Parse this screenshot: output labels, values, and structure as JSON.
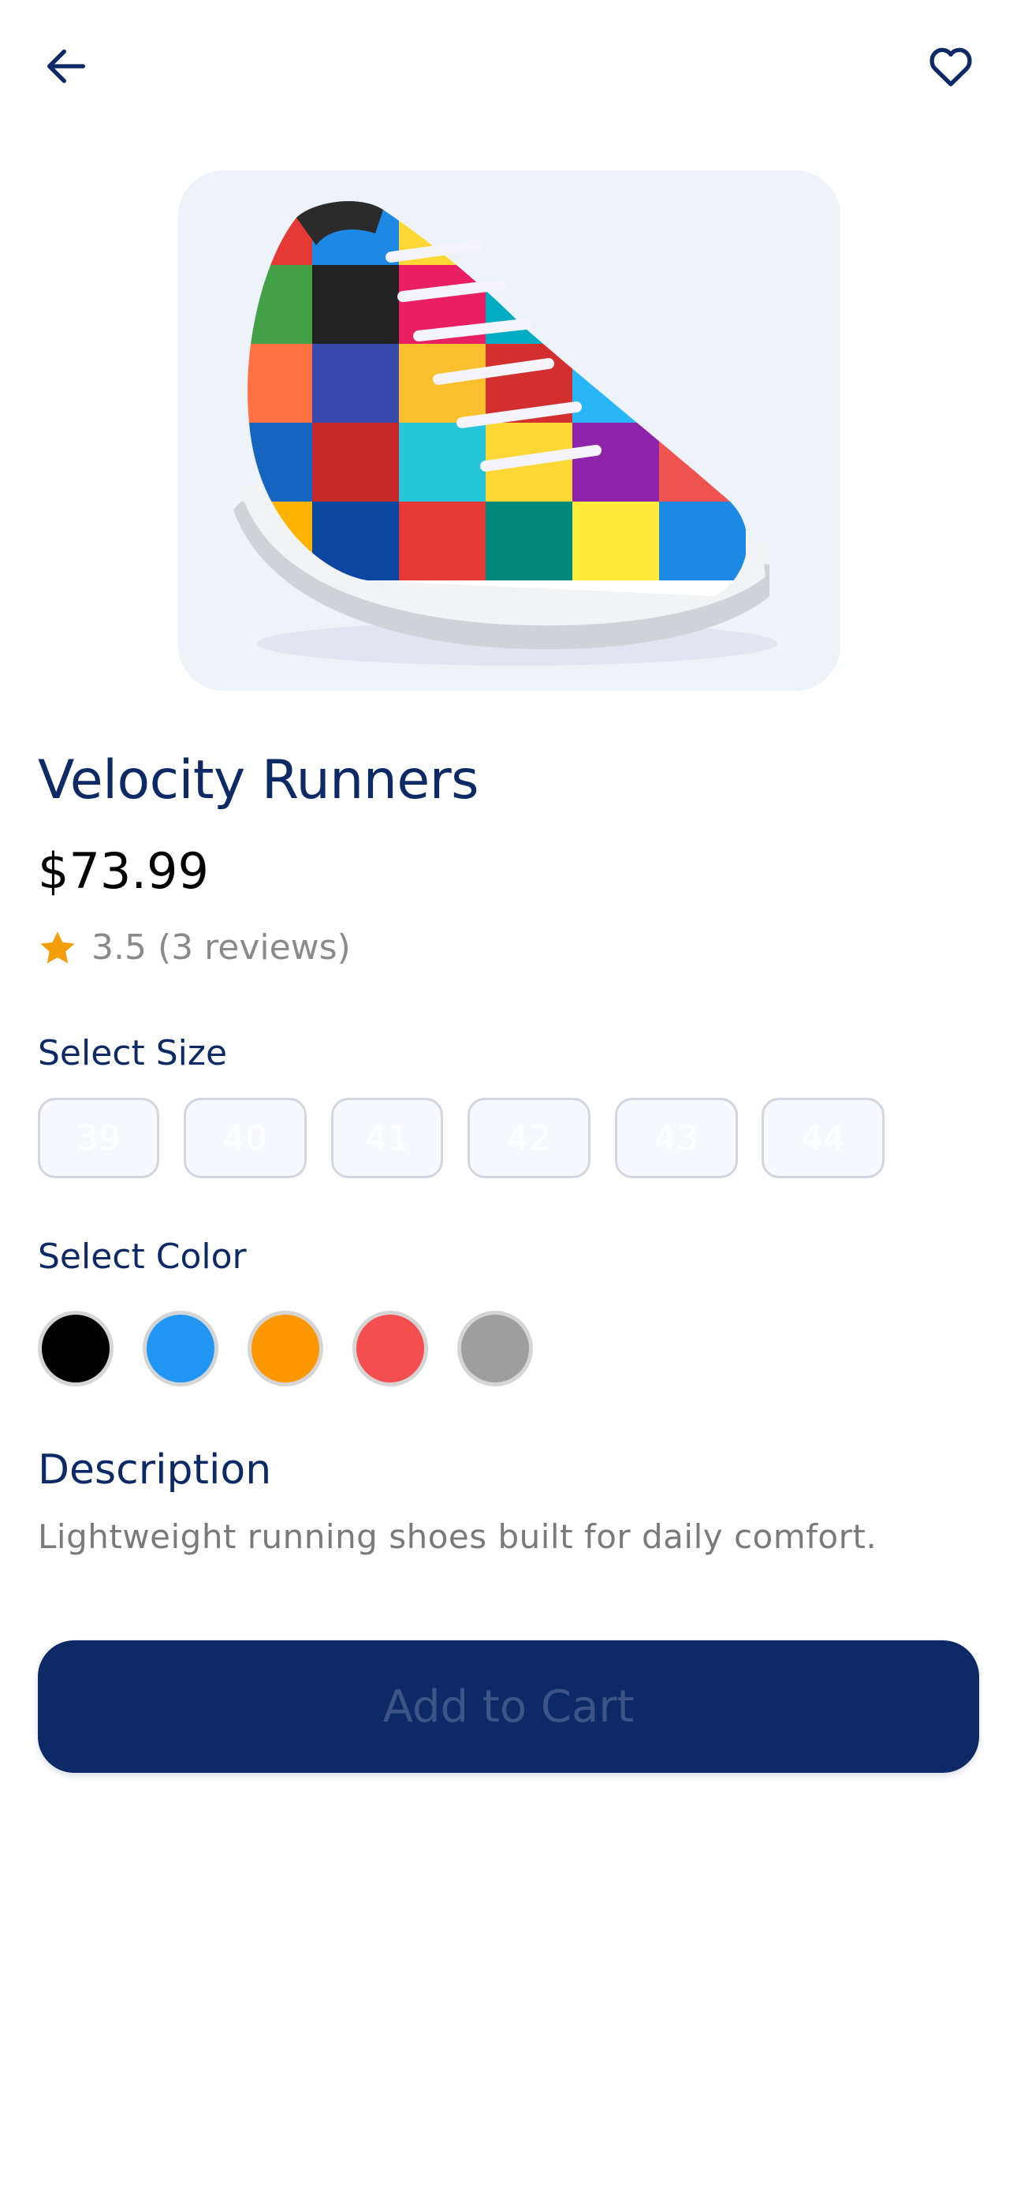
{
  "header": {
    "back_icon": "arrow-left-icon",
    "favorite_icon": "heart-outline-icon"
  },
  "product": {
    "image_icon": "sneaker-product-image",
    "name": "Velocity Runners",
    "price": "$73.99",
    "rating_value": "3.5",
    "reviews_text": "(3 reviews)"
  },
  "size_section": {
    "label": "Select Size",
    "options": [
      "39",
      "40",
      "41",
      "42",
      "43",
      "44"
    ]
  },
  "color_section": {
    "label": "Select Color",
    "options": [
      "#000000",
      "#2196f3",
      "#ff9800",
      "#f44e4e",
      "#9e9e9e"
    ]
  },
  "description": {
    "label": "Description",
    "text": "Lightweight running shoes built for daily comfort."
  },
  "cart_button": {
    "label": "Add to Cart"
  },
  "colors": {
    "primary": "#0d2a66",
    "star": "#f59e0b",
    "muted_text": "#7a7a7a"
  }
}
